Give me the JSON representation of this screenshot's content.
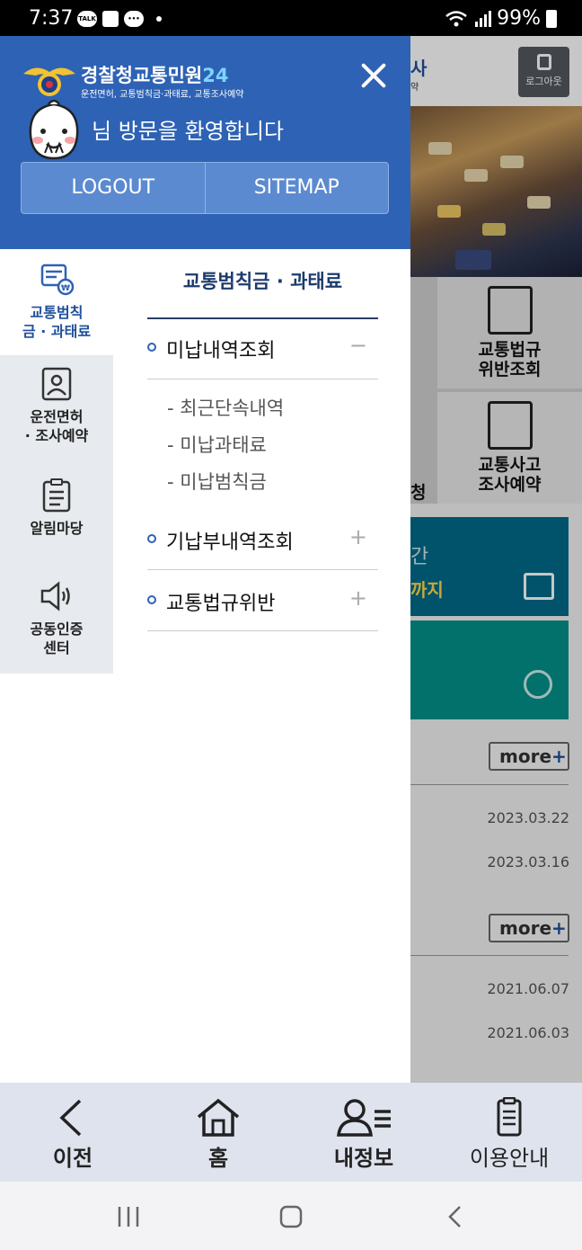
{
  "status_bar": {
    "time": "7:37",
    "battery": "99%",
    "notification_icons": [
      "talk-icon",
      "image-icon",
      "chat-icon"
    ]
  },
  "drawer": {
    "logo_title": "경찰청교통민원",
    "logo_title_num": "24",
    "logo_subtitle": "운전면허, 교통범칙금·과태료, 교통조사예약",
    "welcome_text": "님 방문을 환영합니다",
    "logout_label": "LOGOUT",
    "sitemap_label": "SITEMAP",
    "categories": [
      {
        "label_line1": "교통범칙",
        "label_line2": "금 · 과태료",
        "icon": "fine-card-icon",
        "active": true
      },
      {
        "label_line1": "운전면허",
        "label_line2": "· 조사예약",
        "icon": "license-icon",
        "active": false
      },
      {
        "label_line1": "알림마당",
        "label_line2": "",
        "icon": "clipboard-icon",
        "active": false
      },
      {
        "label_line1": "공동인증",
        "label_line2": "센터",
        "icon": "speaker-icon",
        "active": false
      }
    ],
    "submenu": {
      "title": "교통범칙금 · 과태료",
      "items": [
        {
          "label": "미납내역조회",
          "sign": "−",
          "children": [
            "- 최근단속내역",
            "- 미납과태료",
            "- 미납범칙금"
          ]
        },
        {
          "label": "기납부내역조회",
          "sign": "+"
        },
        {
          "label": "교통법규위반",
          "sign": "+"
        }
      ]
    }
  },
  "background": {
    "header_partial_char": "사",
    "header_partial_sub": "약",
    "logout_label": "로그아웃",
    "tile1_line1": "교통법규",
    "tile1_line2": "위반조회",
    "tile2_partial": "청",
    "tile2_line1": "교통사고",
    "tile2_line2": "조사예약",
    "banner_partial_1": "간",
    "banner_partial_2": "까지",
    "more_label": "more",
    "dates": [
      "2023.03.22",
      "2023.03.16",
      "2021.06.07",
      "2021.06.03"
    ]
  },
  "tab_bar": {
    "prev": "이전",
    "home": "홈",
    "my_info": "내정보",
    "guide": "이용안내"
  },
  "colors": {
    "primary": "#2e62b4",
    "header_button": "#5b8ad0",
    "category_bg": "#e7eaee",
    "teal": "#006b8a",
    "green_teal": "#05918a",
    "tabbar_bg": "#dfe3ed"
  }
}
